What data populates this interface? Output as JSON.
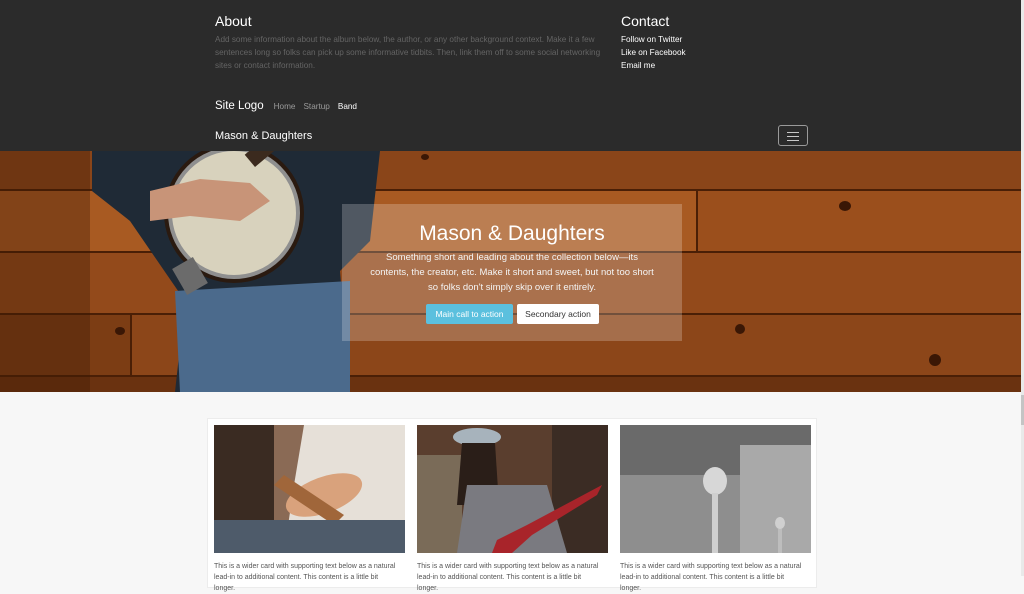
{
  "about": {
    "title": "About",
    "text": "Add some information about the album below, the author, or any other background context. Make it a few sentences long so folks can pick up some informative tidbits. Then, link them off to some social networking sites or contact information."
  },
  "contact": {
    "title": "Contact",
    "links": [
      "Follow on Twitter",
      "Like on Facebook",
      "Email me"
    ]
  },
  "nav": {
    "logo": "Site Logo",
    "links": [
      "Home",
      "Startup",
      "Band"
    ],
    "active": "Band"
  },
  "brand": "Mason & Daughters",
  "hero": {
    "title": "Mason & Daughters",
    "subtitle": "Something short and leading about the collection below—its contents, the creator, etc. Make it short and sweet, but not too short so folks don't simply skip over it entirely.",
    "primary_button": "Main call to action",
    "secondary_button": "Secondary action"
  },
  "cards": [
    {
      "text": "This is a wider card with supporting text below as a natural lead-in to additional content. This content is a little bit longer."
    },
    {
      "text": "This is a wider card with supporting text below as a natural lead-in to additional content. This content is a little bit longer."
    },
    {
      "text": "This is a wider card with supporting text below as a natural lead-in to additional content. This content is a little bit longer."
    }
  ],
  "colors": {
    "topbar": "#2b2b2b",
    "primary_button": "#5bc0de",
    "page_background": "#f7f7f7"
  }
}
